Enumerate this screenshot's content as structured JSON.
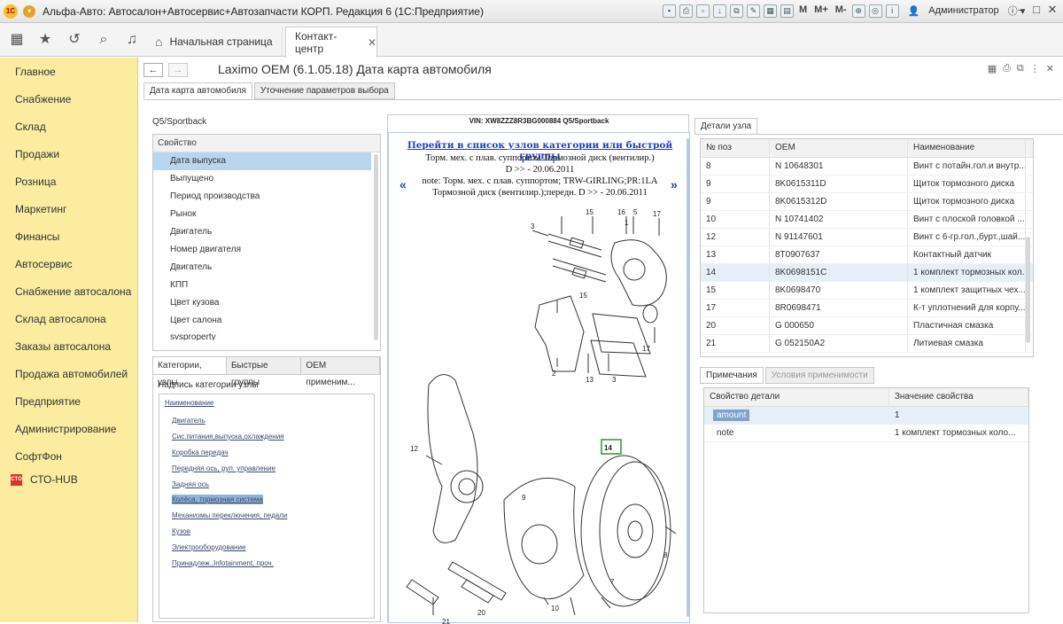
{
  "window": {
    "title": "Альфа-Авто: Автосалон+Автосервис+Автозапчасти КОРП. Редакция 6  (1С:Предприятие)",
    "tools_text": [
      "M",
      "M+",
      "M-"
    ],
    "user": "Администратор"
  },
  "navbar": {
    "home_tab": "Начальная страница",
    "active_tab": "Контакт-центр",
    "close_glyph": "✕"
  },
  "sidebar": {
    "items": [
      "Главное",
      "Снабжение",
      "Склад",
      "Продажи",
      "Розница",
      "Маркетинг",
      "Финансы",
      "Автосервис",
      "Снабжение автосалона",
      "Склад автосалона",
      "Заказы автосалона",
      "Продажа автомобилей",
      "Предприятие",
      "Администрирование",
      "СофтФон",
      "СТО-HUB"
    ]
  },
  "header": {
    "back": "←",
    "forward": "→",
    "title": "Laximo OEM (6.1.05.18) Дата карта автомобиля"
  },
  "subtabs": [
    "Дата карта автомобиля",
    "Уточнение параметров выбора"
  ],
  "model": "Q5/Sportback",
  "properties": {
    "header": "Свойство",
    "rows": [
      "Дата выпуска",
      "Выпущено",
      "Период производства",
      "Рынок",
      "Двигатель",
      "Номер двигателя",
      "Двигатель",
      "КПП",
      "Цвет кузова",
      "Цвет салона",
      "svsproperty"
    ]
  },
  "categories": {
    "tabs": [
      "Категории, узлы",
      "Быстрые группы",
      "OEM применим..."
    ],
    "caption": "Надпись категории узлы",
    "items": [
      "Наименование",
      "Двигатель",
      "Сис.питания,выпуска,охлаждения",
      "Коробка передач",
      "Передняя ось, рул. управление",
      "Задняя ось",
      "Колёса, тормозная система",
      "Механизмы переключения, педали",
      "Кузов",
      "Электрооборудование",
      "Принадлеж.,Infotainment, проч."
    ]
  },
  "diagram": {
    "vin": "VIN: XW8ZZZ8R3BG000884 Q5/Sportback",
    "link": "Перейти в список узлов категории или быстрой группы",
    "line1": "Торм. мех. с плав. суппортом Тормозной диск (вентилир.)",
    "line2": "D >> - 20.06.2011",
    "line3": "note: Торм. мех. с плав. суппортом; TRW-GIRLING;PR:1LA",
    "line4": "Тормозной диск (вентилир.);передн. D >> - 20.06.2011",
    "arrow_left": "«",
    "arrow_right": "»",
    "labels": [
      "15",
      "16",
      "5",
      "1",
      "17",
      "3",
      "15",
      "12",
      "2",
      "13",
      "3",
      "17",
      "14",
      "9",
      "10",
      "8",
      "7",
      "20",
      "21"
    ]
  },
  "parts": {
    "tab": "Детали узла",
    "columns": [
      "№ поз",
      "OEM",
      "Наименование"
    ],
    "rows": [
      [
        "8",
        "N 10648301",
        "Винт с потайн.гол.и внутр..."
      ],
      [
        "9",
        "8K0615311D",
        "Щиток тормозного диска"
      ],
      [
        "9",
        "8K0615312D",
        "Щиток тормозного диска"
      ],
      [
        "10",
        "N 10741402",
        "Винт с плоской головкой ..."
      ],
      [
        "12",
        "N 91147601",
        "Винт с 6-гр.гол.,бурт.,шай..."
      ],
      [
        "13",
        "8T0907637",
        "Контактный датчик"
      ],
      [
        "14",
        "8K0698151C",
        "1 комплект тормозных кол..."
      ],
      [
        "15",
        "8K0698470",
        "1 комплект защитных чех..."
      ],
      [
        "17",
        "8R0698471",
        "К-т уплотнений для корпу..."
      ],
      [
        "20",
        "G 000650",
        "Пластичная смазка"
      ],
      [
        "21",
        "G 052150A2",
        "Литиевая смазка"
      ]
    ],
    "selected_index": 6
  },
  "notes": {
    "tabs": [
      "Примечания",
      "Условия применимости"
    ],
    "columns": [
      "Свойство детали",
      "Значение свойства"
    ],
    "rows": [
      [
        "amount",
        "1"
      ],
      [
        "note",
        "1 комплект тормозных коло..."
      ]
    ]
  }
}
